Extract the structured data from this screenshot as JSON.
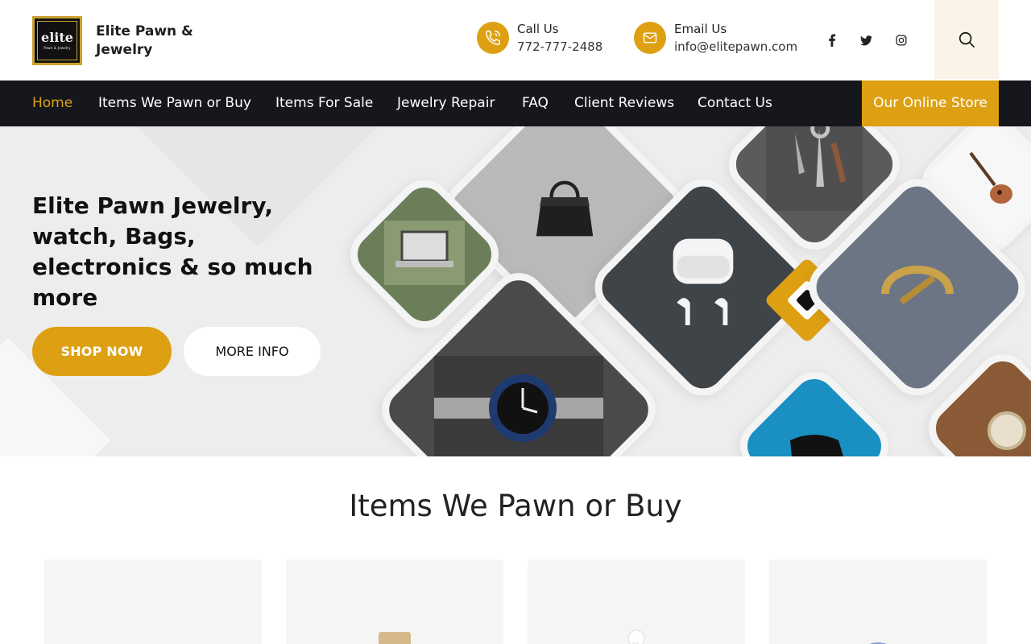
{
  "brand": {
    "logo_line1": "elite",
    "logo_line2": "Pawn & Jewelry",
    "name": "Elite Pawn & Jewelry"
  },
  "contact": {
    "call_label": "Call Us",
    "call_value": "772-777-2488",
    "email_label": "Email Us",
    "email_value": "info@elitepawn.com"
  },
  "social": [
    "facebook-icon",
    "twitter-icon",
    "instagram-icon"
  ],
  "nav": {
    "items": [
      {
        "label": "Home",
        "active": true
      },
      {
        "label": "Items We Pawn or Buy"
      },
      {
        "label": "Items For Sale"
      },
      {
        "label": "Jewelry Repair"
      },
      {
        "label": "FAQ"
      },
      {
        "label": "Client Reviews"
      },
      {
        "label": "Contact Us"
      }
    ],
    "store_label": "Our Online Store"
  },
  "hero": {
    "title": "Elite Pawn Jewelry, watch, Bags, electronics & so much more",
    "shop_label": "SHOP NOW",
    "more_label": "MORE INFO"
  },
  "section": {
    "title": "Items We Pawn or Buy"
  },
  "colors": {
    "accent": "#dea013",
    "nav_bg": "#15171c",
    "hero_bg": "#ededed"
  }
}
